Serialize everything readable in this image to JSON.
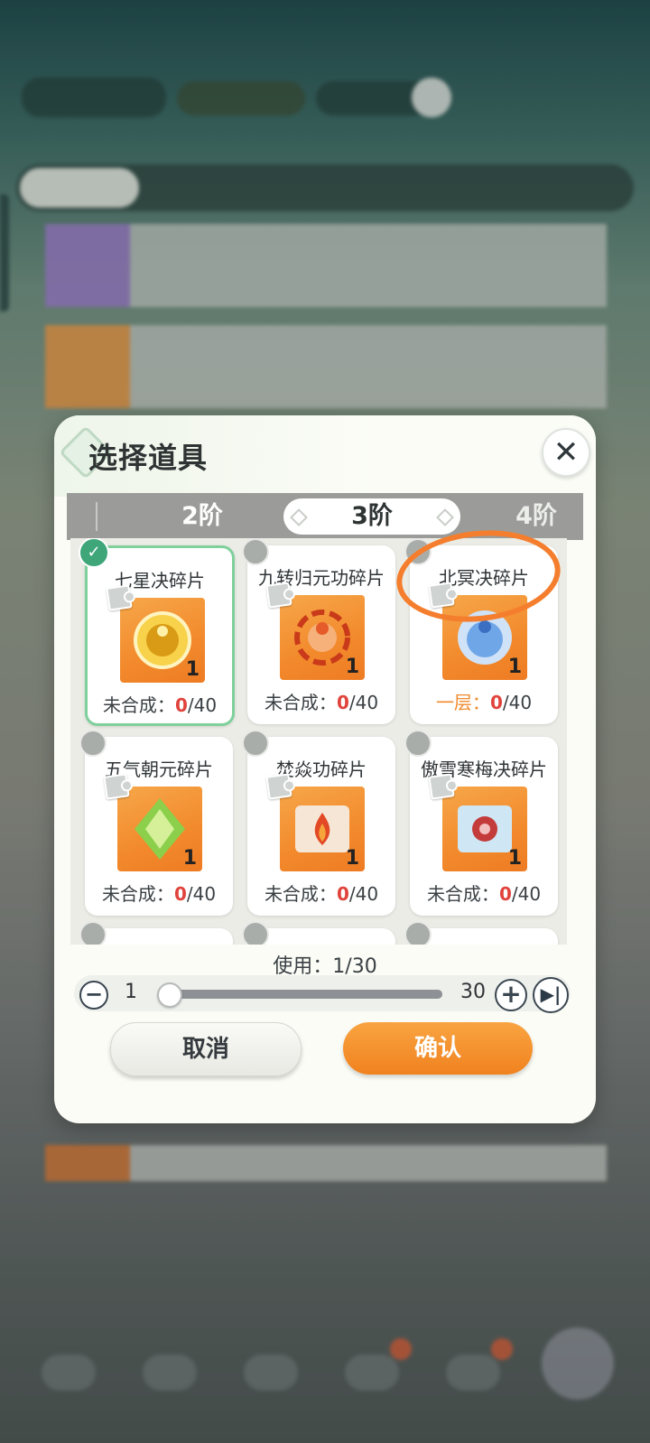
{
  "dialog": {
    "title": "选择道具",
    "close_icon": "close-icon",
    "tiers": [
      "2阶",
      "3阶",
      "4阶"
    ],
    "active_tier": "3阶"
  },
  "items": [
    {
      "name": "七星决碎片",
      "count": "1",
      "status_label": "未合成：",
      "progress": "0",
      "total": "/40",
      "selected": true,
      "art": "golden-sphere",
      "art_colors": [
        "#f7d24a",
        "#d99a15"
      ]
    },
    {
      "name": "九转归元功碎片",
      "count": "1",
      "status_label": "未合成：",
      "progress": "0",
      "total": "/40",
      "selected": false,
      "art": "red-flame-figure",
      "art_colors": [
        "#e65b2a",
        "#f6b079"
      ]
    },
    {
      "name": "北冥决碎片",
      "count": "1",
      "status_label": "一层：",
      "progress": "0",
      "total": "/40",
      "selected": false,
      "art": "blue-orb-figure",
      "art_colors": [
        "#6fa6e8",
        "#cfe2f7"
      ]
    },
    {
      "name": "五气朝元碎片",
      "count": "1",
      "status_label": "未合成：",
      "progress": "0",
      "total": "/40",
      "selected": false,
      "art": "green-crystal",
      "art_colors": [
        "#8bcf4b",
        "#d6f09a"
      ]
    },
    {
      "name": "焚焱功碎片",
      "count": "1",
      "status_label": "未合成：",
      "progress": "0",
      "total": "/40",
      "selected": false,
      "art": "fire-scroll",
      "art_colors": [
        "#f6e6d6",
        "#e24a26"
      ]
    },
    {
      "name": "傲雪寒梅决碎片",
      "count": "1",
      "status_label": "未合成：",
      "progress": "0",
      "total": "/40",
      "selected": false,
      "art": "ice-scroll",
      "art_colors": [
        "#cfe6f5",
        "#c43b3b"
      ]
    }
  ],
  "use": {
    "label": "使用：1/30",
    "min": "1",
    "max": "30",
    "fraction": 0.0
  },
  "buttons": {
    "cancel": "取消",
    "confirm": "确认"
  },
  "colors": {
    "accent_orange": "#f0821f",
    "selected_green": "#3fa67a",
    "progress_red": "#e0443c"
  }
}
